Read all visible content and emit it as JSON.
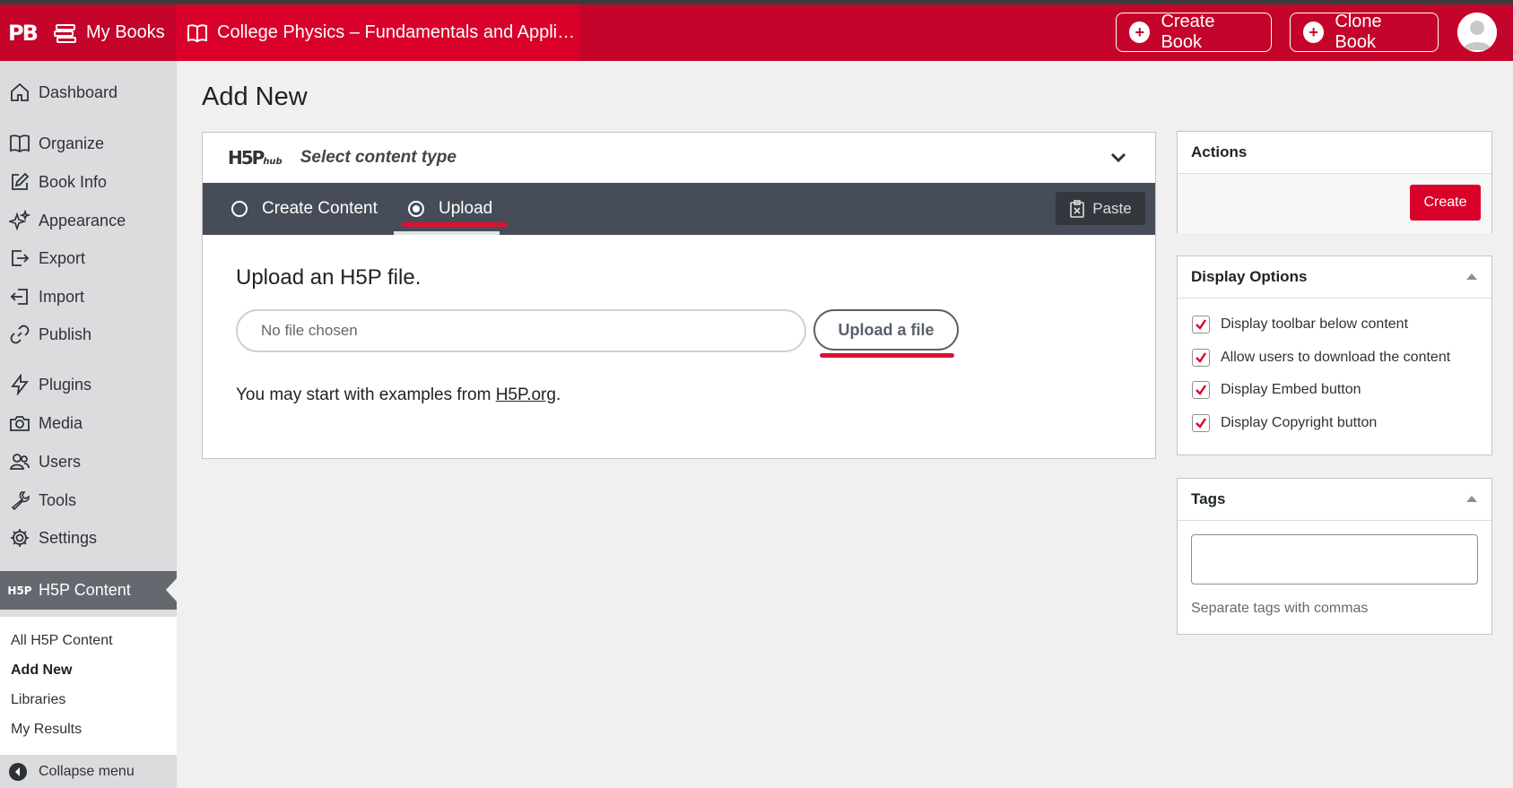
{
  "topbar": {
    "logo": "PB",
    "my_books": "My Books",
    "book_title": "College Physics – Fundamentals and Appli…",
    "create_book": "Create Book",
    "clone_book": "Clone Book"
  },
  "sidebar": {
    "items": [
      {
        "label": "Dashboard",
        "icon": "home-icon"
      },
      {
        "label": "Organize",
        "icon": "book-open-icon"
      },
      {
        "label": "Book Info",
        "icon": "pencil-square-icon"
      },
      {
        "label": "Appearance",
        "icon": "sparkles-icon"
      },
      {
        "label": "Export",
        "icon": "export-icon"
      },
      {
        "label": "Import",
        "icon": "import-icon"
      },
      {
        "label": "Publish",
        "icon": "link-icon"
      },
      {
        "label": "Plugins",
        "icon": "bolt-icon"
      },
      {
        "label": "Media",
        "icon": "camera-icon"
      },
      {
        "label": "Users",
        "icon": "users-icon"
      },
      {
        "label": "Tools",
        "icon": "wrench-icon"
      },
      {
        "label": "Settings",
        "icon": "gear-icon"
      }
    ],
    "active": {
      "label": "H5P Content",
      "icon_text": "H5P"
    },
    "submenu": [
      "All H5P Content",
      "Add New",
      "Libraries",
      "My Results"
    ],
    "collapse": "Collapse menu"
  },
  "main": {
    "title": "Add New",
    "hub": {
      "logo": "H5P",
      "logo_sub": "hub",
      "select": "Select content type"
    },
    "tabs": {
      "create": "Create Content",
      "upload": "Upload",
      "selected": "Upload"
    },
    "paste": "Paste",
    "upload_title": "Upload an H5P file.",
    "file_placeholder": "No file chosen",
    "upload_button": "Upload a file",
    "examples_prefix": "You may start with examples from ",
    "examples_link": "H5P.org",
    "examples_suffix": "."
  },
  "actions": {
    "title": "Actions",
    "create": "Create"
  },
  "display_options": {
    "title": "Display Options",
    "options": [
      {
        "label": "Display toolbar below content",
        "checked": true
      },
      {
        "label": "Allow users to download the content",
        "checked": true
      },
      {
        "label": "Display Embed button",
        "checked": true
      },
      {
        "label": "Display Copyright button",
        "checked": true
      }
    ]
  },
  "tags": {
    "title": "Tags",
    "value": "",
    "help": "Separate tags with commas"
  },
  "colors": {
    "brand": "#c4042a",
    "tabbar": "#474d58",
    "annotation": "#dd1133"
  }
}
